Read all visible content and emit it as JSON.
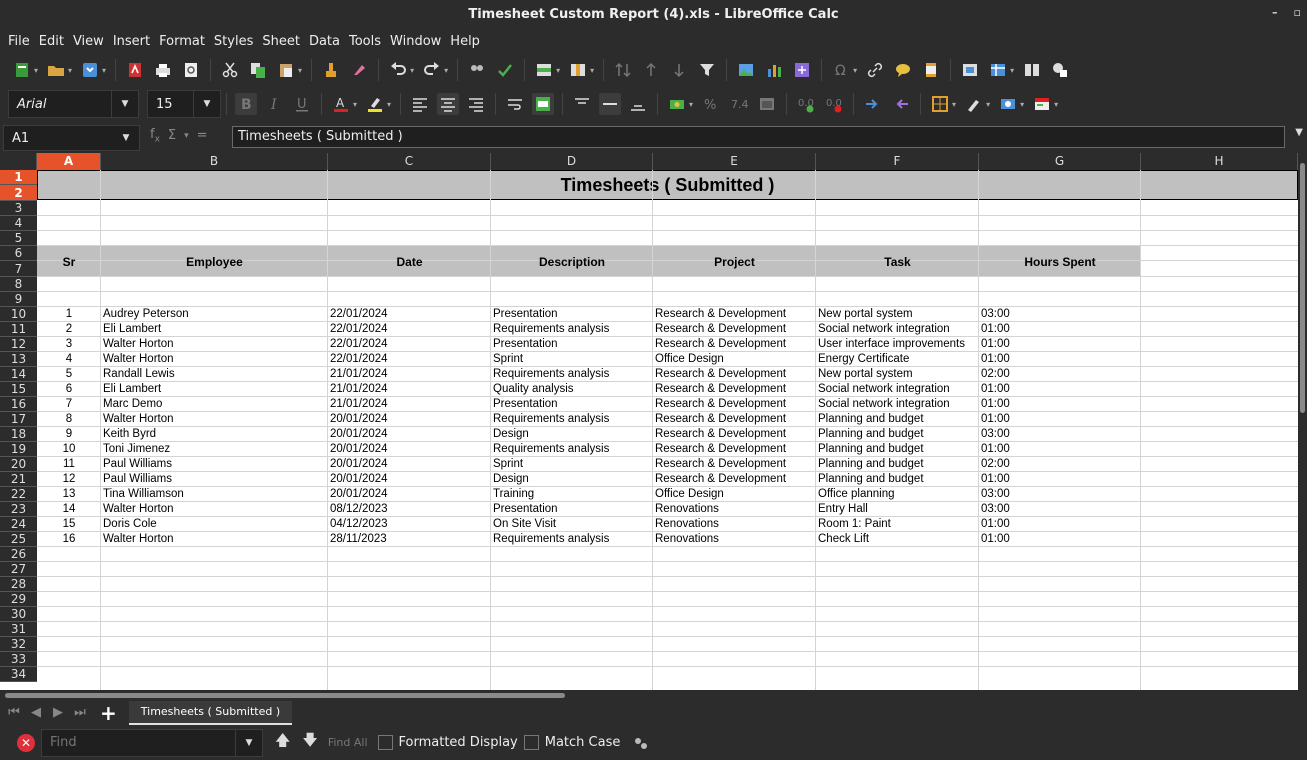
{
  "window": {
    "title": "Timesheet Custom Report (4).xls - LibreOffice Calc",
    "min_glyph": "–",
    "max_glyph": "▫"
  },
  "menu": [
    "File",
    "Edit",
    "View",
    "Insert",
    "Format",
    "Styles",
    "Sheet",
    "Data",
    "Tools",
    "Window",
    "Help"
  ],
  "format_bar": {
    "font_name": "Arial",
    "font_size": "15"
  },
  "formula_bar": {
    "cell_ref": "A1",
    "content": "Timesheets ( Submitted )"
  },
  "columns": [
    "A",
    "B",
    "C",
    "D",
    "E",
    "F",
    "G",
    "H"
  ],
  "selected_column": "A",
  "selected_rows": [
    "1",
    "2"
  ],
  "row_numbers": [
    "1",
    "2",
    "3",
    "4",
    "5",
    "6",
    "7",
    "8",
    "9",
    "10",
    "11",
    "12",
    "13",
    "14",
    "15",
    "16",
    "17",
    "18",
    "19",
    "20",
    "21",
    "22",
    "23",
    "24",
    "25",
    "26",
    "27",
    "28",
    "29",
    "30",
    "31",
    "32",
    "33",
    "34"
  ],
  "sheet": {
    "title": "Timesheets ( Submitted )",
    "headers": [
      "Sr",
      "Employee",
      "Date",
      "Description",
      "Project",
      "Task",
      "Hours Spent"
    ],
    "rows": [
      [
        "1",
        "Audrey Peterson",
        "22/01/2024",
        "Presentation",
        "Research & Development",
        "New portal system",
        "03:00"
      ],
      [
        "2",
        "Eli Lambert",
        "22/01/2024",
        "Requirements analysis",
        "Research & Development",
        "Social network integration",
        "01:00"
      ],
      [
        "3",
        "Walter Horton",
        "22/01/2024",
        "Presentation",
        "Research & Development",
        "User interface improvements",
        "01:00"
      ],
      [
        "4",
        "Walter Horton",
        "22/01/2024",
        "Sprint",
        "Office Design",
        "Energy Certificate",
        "01:00"
      ],
      [
        "5",
        "Randall Lewis",
        "21/01/2024",
        "Requirements analysis",
        "Research & Development",
        "New portal system",
        "02:00"
      ],
      [
        "6",
        "Eli Lambert",
        "21/01/2024",
        "Quality analysis",
        "Research & Development",
        "Social network integration",
        "01:00"
      ],
      [
        "7",
        "Marc Demo",
        "21/01/2024",
        "Presentation",
        "Research & Development",
        "Social network integration",
        "01:00"
      ],
      [
        "8",
        "Walter Horton",
        "20/01/2024",
        "Requirements analysis",
        "Research & Development",
        "Planning and budget",
        "01:00"
      ],
      [
        "9",
        "Keith Byrd",
        "20/01/2024",
        "Design",
        "Research & Development",
        "Planning and budget",
        "03:00"
      ],
      [
        "10",
        "Toni Jimenez",
        "20/01/2024",
        "Requirements analysis",
        "Research & Development",
        "Planning and budget",
        "01:00"
      ],
      [
        "11",
        "Paul Williams",
        "20/01/2024",
        "Sprint",
        "Research & Development",
        "Planning and budget",
        "02:00"
      ],
      [
        "12",
        "Paul Williams",
        "20/01/2024",
        "Design",
        "Research & Development",
        "Planning and budget",
        "01:00"
      ],
      [
        "13",
        "Tina Williamson",
        "20/01/2024",
        "Training",
        "Office Design",
        "Office planning",
        "03:00"
      ],
      [
        "14",
        "Walter Horton",
        "08/12/2023",
        "Presentation",
        "Renovations",
        "Entry Hall",
        "03:00"
      ],
      [
        "15",
        "Doris Cole",
        "04/12/2023",
        "On Site Visit",
        "Renovations",
        "Room 1: Paint",
        "01:00"
      ],
      [
        "16",
        "Walter Horton",
        "28/11/2023",
        "Requirements analysis",
        "Renovations",
        "Check Lift",
        "01:00"
      ]
    ]
  },
  "sheet_tabs": [
    "Timesheets ( Submitted )"
  ],
  "find_bar": {
    "placeholder": "Find",
    "find_all": "Find All",
    "formatted_display": "Formatted Display",
    "match_case": "Match Case"
  }
}
